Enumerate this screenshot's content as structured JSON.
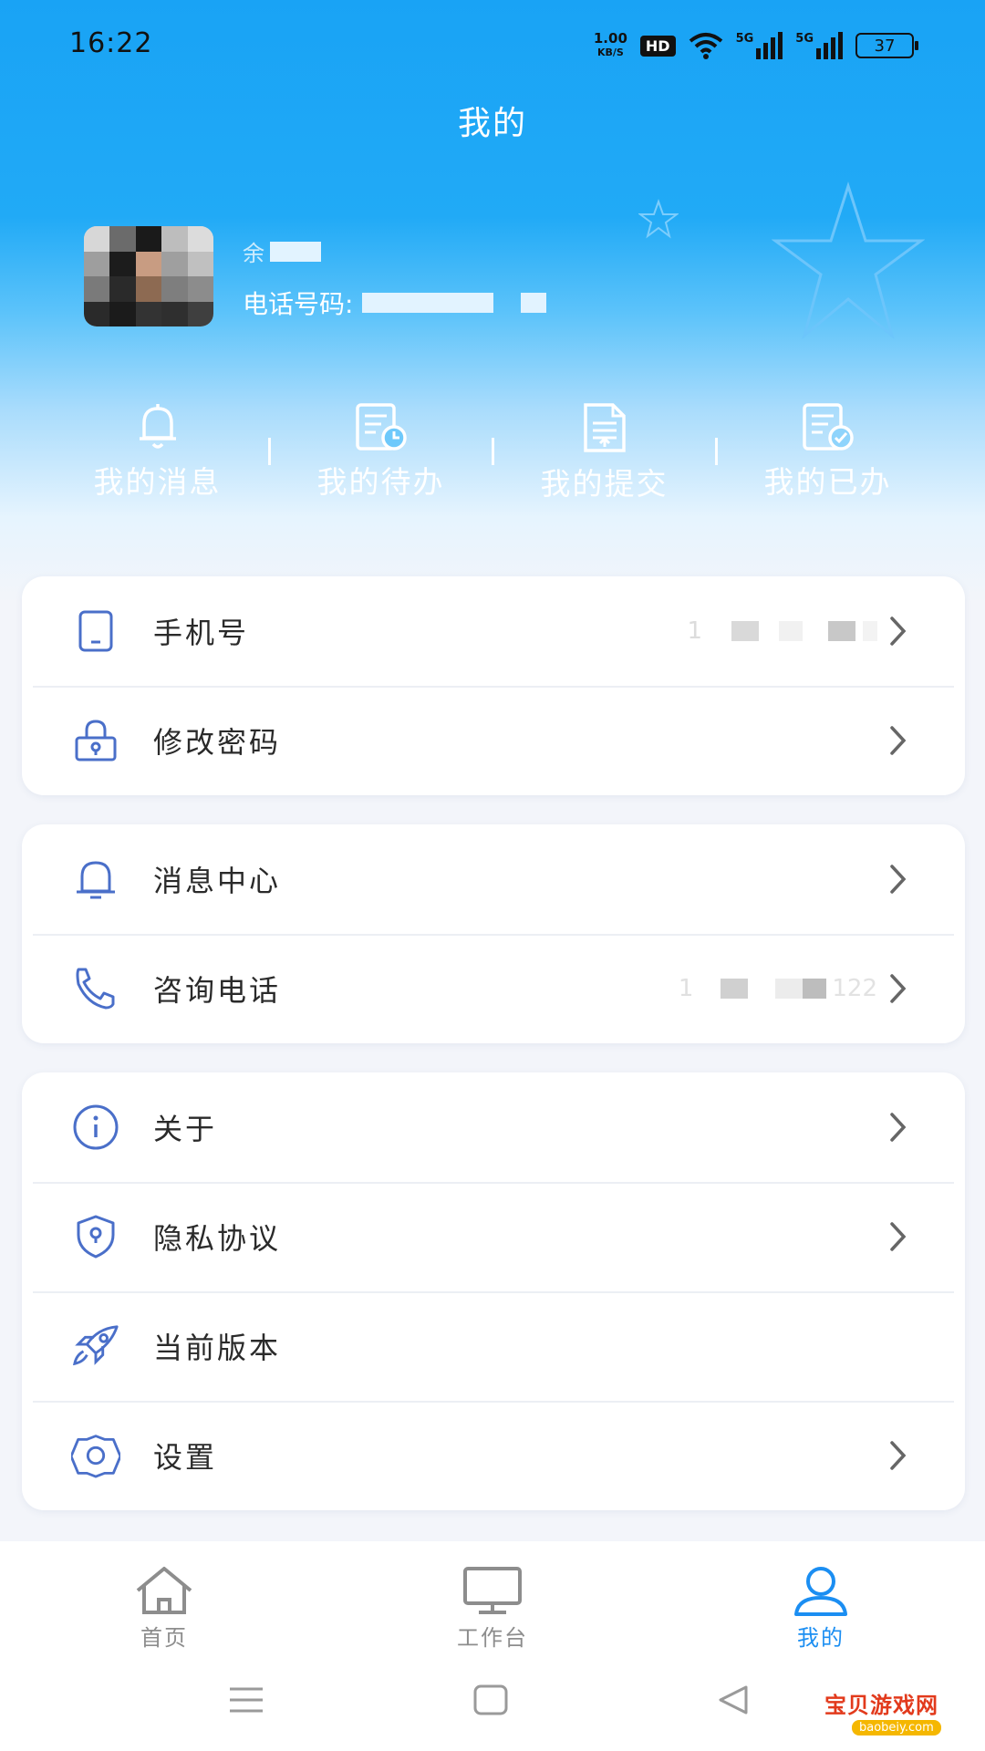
{
  "status": {
    "time": "16:22",
    "net_speed_value": "1.00",
    "net_speed_unit": "KB/S",
    "hd": "HD",
    "net1": "5G",
    "net2": "5G",
    "battery": "37"
  },
  "header": {
    "title": "我的",
    "user_name_initial": "余",
    "phone_label": "电话号码:"
  },
  "quick_actions": [
    {
      "label": "我的消息",
      "icon": "bell-icon"
    },
    {
      "label": "我的待办",
      "icon": "todo-clock-icon"
    },
    {
      "label": "我的提交",
      "icon": "submit-doc-icon"
    },
    {
      "label": "我的已办",
      "icon": "done-check-icon"
    }
  ],
  "card1": {
    "phone": {
      "label": "手机号",
      "value_prefix": "1",
      "icon": "phone-icon"
    },
    "password": {
      "label": "修改密码",
      "icon": "lock-icon"
    }
  },
  "card2": {
    "messages": {
      "label": "消息中心",
      "icon": "bell-icon"
    },
    "hotline": {
      "label": "咨询电话",
      "value_prefix": "1",
      "value_suffix": "122",
      "icon": "telephone-icon"
    }
  },
  "card3": {
    "about": {
      "label": "关于",
      "icon": "info-icon"
    },
    "privacy": {
      "label": "隐私协议",
      "icon": "shield-icon"
    },
    "version": {
      "label": "当前版本",
      "icon": "rocket-icon"
    },
    "settings": {
      "label": "设置",
      "icon": "gear-icon"
    }
  },
  "tabs": [
    {
      "label": "首页",
      "icon": "home-icon",
      "active": false
    },
    {
      "label": "工作台",
      "icon": "monitor-icon",
      "active": false
    },
    {
      "label": "我的",
      "icon": "user-icon",
      "active": true
    }
  ],
  "colors": {
    "header": "#19a3f5",
    "accent": "#1b8ef2",
    "icon": "#4a6fc9",
    "tab_inactive": "#8d8d8d"
  },
  "watermark": {
    "text": "宝贝游戏网",
    "url": "baobeiy.com"
  }
}
